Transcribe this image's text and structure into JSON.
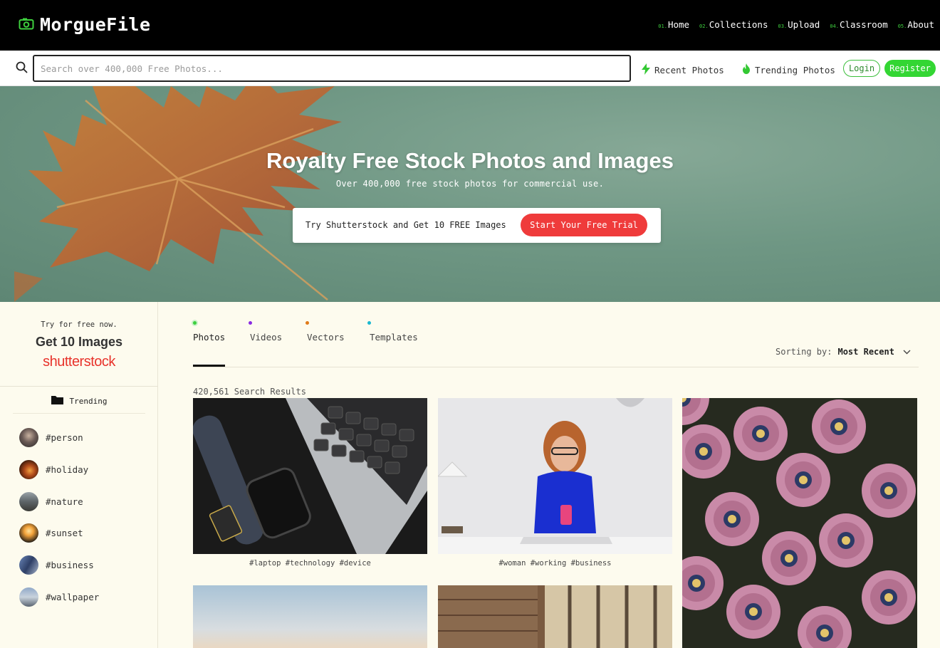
{
  "brand": {
    "name": "MorgueFile"
  },
  "nav": [
    {
      "num": "01.",
      "label": "Home"
    },
    {
      "num": "02.",
      "label": "Collections"
    },
    {
      "num": "03.",
      "label": "Upload"
    },
    {
      "num": "04.",
      "label": "Classroom"
    },
    {
      "num": "05.",
      "label": "About"
    }
  ],
  "search": {
    "placeholder": "Search over 400,000 Free Photos...",
    "value": ""
  },
  "quick_links": {
    "recent": "Recent Photos",
    "trending": "Trending Photos"
  },
  "auth": {
    "login": "Login",
    "register": "Register"
  },
  "hero": {
    "title": "Royalty Free Stock Photos and Images",
    "subtitle": "Over 400,000 free stock photos for commercial use.",
    "promo_text": "Try Shutterstock and Get 10 FREE Images",
    "promo_button": "Start Your Free Trial"
  },
  "sidebar": {
    "ad_small": "Try for free now.",
    "ad_big": "Get 10 Images",
    "ad_brand": "shutterstock",
    "trending_label": "Trending",
    "tags": [
      "#person",
      "#holiday",
      "#nature",
      "#sunset",
      "#business",
      "#wallpaper"
    ]
  },
  "tabs": [
    {
      "label": "Photos",
      "color": "#3ecf3e"
    },
    {
      "label": "Videos",
      "color": "#8a2be2"
    },
    {
      "label": "Vectors",
      "color": "#e07b1a"
    },
    {
      "label": "Templates",
      "color": "#1ab8d0"
    }
  ],
  "sorting": {
    "label": "Sorting by:",
    "value": "Most Recent"
  },
  "results": {
    "count": "420,561 Search Results"
  },
  "photos": [
    {
      "caption": "#laptop #technology #device"
    },
    {
      "caption": "#woman #working #business"
    },
    {
      "caption": ""
    }
  ],
  "colors": {
    "accent": "#33d633",
    "promo": "#ef3b3b",
    "background": "#fdfbee"
  }
}
